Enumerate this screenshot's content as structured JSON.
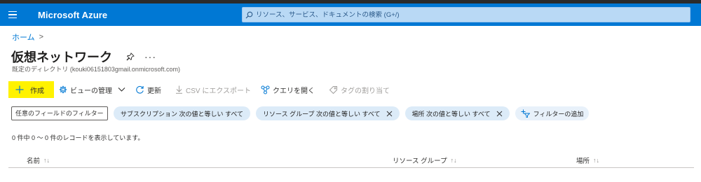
{
  "header": {
    "brand": "Microsoft Azure",
    "search_placeholder": "リソース、サービス、ドキュメントの検索 (G+/)",
    "accent": "#0078d4"
  },
  "breadcrumb": {
    "home": "ホーム",
    "separator": ">"
  },
  "page": {
    "title": "仮想ネットワーク",
    "more": "···",
    "subtitle": "既定のディレクトリ (kouki06151803gmail.onmicrosoft.com)"
  },
  "toolbar": {
    "create": "作成",
    "manage_view": "ビューの管理",
    "refresh": "更新",
    "export_csv": "CSV にエクスポート",
    "open_query": "クエリを開く",
    "assign_tags": "タグの割り当て",
    "icons": [
      "plus-icon",
      "gear-icon",
      "chevron-down-icon",
      "refresh-icon",
      "download-icon",
      "query-icon",
      "tag-icon"
    ]
  },
  "filters": {
    "field_placeholder": "任意のフィールドのフィルター...",
    "subscription": "サブスクリプション 次の値と等しい すべて",
    "resource_group": "リソース グループ 次の値と等しい すべて",
    "location": "場所 次の値と等しい すべて",
    "add_filter": "フィルターの追加",
    "pill_color": "#dcebf8"
  },
  "records": "0 件中 0 ～ 0 件のレコードを表示しています。",
  "table": {
    "columns": [
      {
        "label": "名前",
        "sort": "↑↓"
      },
      {
        "label": "リソース グループ",
        "sort": "↑↓"
      },
      {
        "label": "場所",
        "sort": "↑↓"
      }
    ]
  }
}
